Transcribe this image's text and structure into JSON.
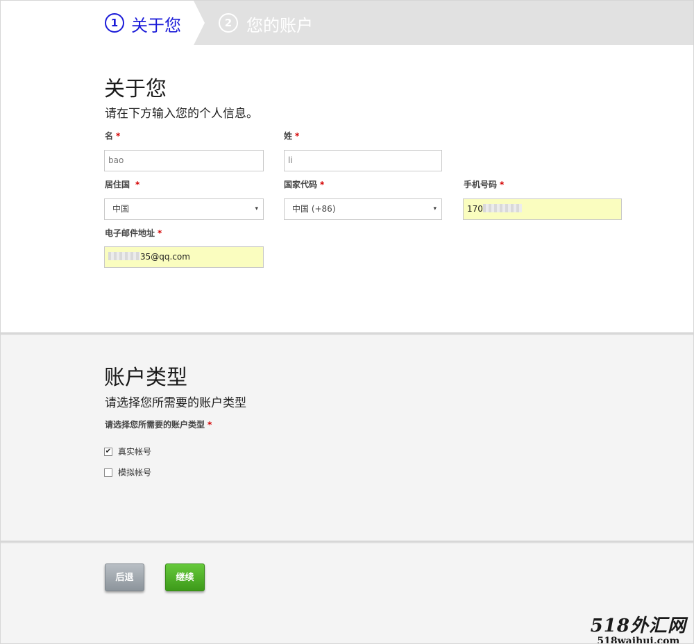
{
  "steps": [
    {
      "number": "1",
      "label": "关于您"
    },
    {
      "number": "2",
      "label": "您的账户"
    }
  ],
  "about": {
    "title": "关于您",
    "subtitle": "请在下方输入您的个人信息。",
    "required_mark": "*",
    "first_name": {
      "label": "名",
      "value": "bao"
    },
    "last_name": {
      "label": "姓",
      "value": "li"
    },
    "residence": {
      "label": "居住国",
      "value": "中国"
    },
    "country_code": {
      "label": "国家代码",
      "value": "中国 (+86)"
    },
    "phone": {
      "label": "手机号码",
      "value": "170"
    },
    "email": {
      "label": "电子邮件地址",
      "value": "35@qq.com"
    }
  },
  "account": {
    "title": "账户类型",
    "subtitle": "请选择您所需要的账户类型",
    "field_label": "请选择您所需要的账户类型",
    "options": [
      {
        "label": "真实帐号",
        "checked": true
      },
      {
        "label": "模拟帐号",
        "checked": false
      }
    ]
  },
  "buttons": {
    "back": "后退",
    "next": "继续"
  },
  "watermark": {
    "brand": "518外汇网",
    "domain": "518waihui.com"
  },
  "colors": {
    "step_active": "#1a1ad8",
    "required": "#d40000",
    "autofill": "#fafdbf",
    "next_button": "#4caf24",
    "back_button": "#9ca3a9"
  },
  "icons": {
    "select_caret": "▾",
    "check_mark": "✔"
  }
}
